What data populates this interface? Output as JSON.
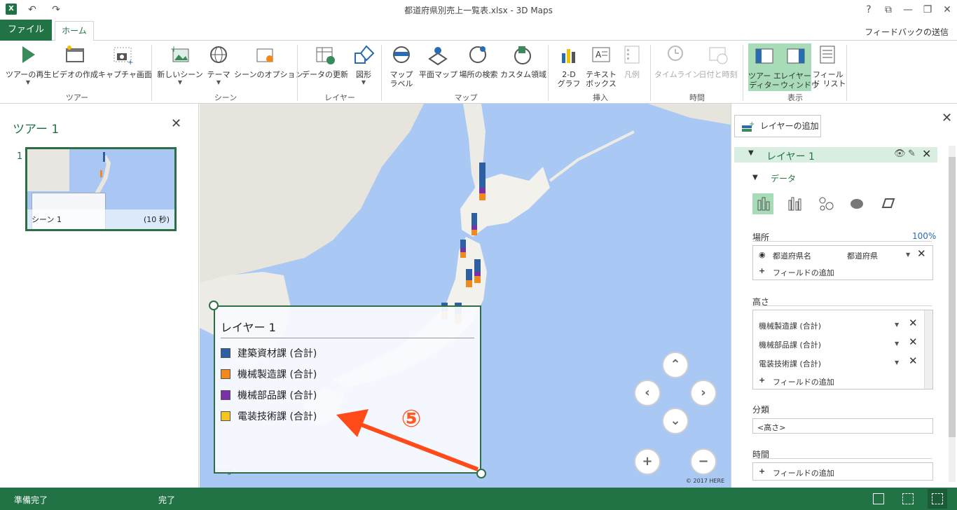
{
  "window": {
    "title": "都道府県別売上一覧表.xlsx - 3D Maps",
    "controls": [
      "?",
      "⧉",
      "—",
      "❐",
      "✕"
    ]
  },
  "tabs": {
    "file": "ファイル",
    "home": "ホーム",
    "feedback": "フィードバックの送信"
  },
  "ribbon": {
    "groups": {
      "tour": "ツアー",
      "scene": "シーン",
      "layer": "レイヤー",
      "map": "マップ",
      "insert": "挿入",
      "time": "時間",
      "view": "表示"
    },
    "buttons": {
      "play_tour": "ツアーの再生",
      "create_video": "ビデオの作成",
      "capture_screen": "キャプチャ画面",
      "new_scene": "新しいシーン",
      "theme": "テーマ",
      "scene_options": "シーンのオプション",
      "refresh_data": "データの更新",
      "shapes": "図形",
      "map_labels_1": "マップ",
      "map_labels_2": "ラベル",
      "flat_map": "平面マップ",
      "find_location": "場所の検索",
      "custom_region": "カスタム領域",
      "chart2d_1": "2-D",
      "chart2d_2": "グラフ",
      "textbox_1": "テキスト",
      "textbox_2": "ボックス",
      "legend": "凡例",
      "timeline": "タイムライン",
      "datetime": "日付と時刻",
      "tour_editor_1": "ツアー エ",
      "tour_editor_2": "ディター",
      "layer_pane_1": "レイヤー",
      "layer_pane_2": "ウィンドウ",
      "field_list_1": "フィール",
      "field_list_2": "ド リスト"
    }
  },
  "tour": {
    "title": "ツアー 1",
    "scene_number": "1",
    "scene_name": "シーン 1",
    "scene_duration": "(10 秒)"
  },
  "map": {
    "copyright": "© 2017 HERE",
    "bing": "bing",
    "nav": {
      "up": "⌃",
      "down": "⌄",
      "left": "‹",
      "right": "›",
      "zoom_in": "+",
      "zoom_out": "−"
    }
  },
  "legend": {
    "title": "レイヤー 1",
    "items": [
      {
        "label": "建築資材課 (合計)",
        "color": "#2e5fa3"
      },
      {
        "label": "機械製造課 (合計)",
        "color": "#f08a1f"
      },
      {
        "label": "機械部品課 (合計)",
        "color": "#7b2fa8"
      },
      {
        "label": "電装技術課 (合計)",
        "color": "#f5c322"
      }
    ]
  },
  "callout": {
    "number": "⑤",
    "color": "#ff5a22"
  },
  "layer_pane": {
    "add_layer": "レイヤーの追加",
    "layer_name": "レイヤー 1",
    "data_section": "データ",
    "location_label": "場所",
    "location_pct": "100%",
    "location_field": "都道府県名",
    "location_type": "都道府県",
    "add_field": "フィールドの追加",
    "height_label": "高さ",
    "height_fields": [
      "機械製造課 (合計)",
      "機械部品課 (合計)",
      "電装技術課 (合計)"
    ],
    "category_label": "分類",
    "category_value": "<高さ>",
    "time_label": "時間"
  },
  "status": {
    "ready": "準備完了",
    "done": "完了"
  }
}
